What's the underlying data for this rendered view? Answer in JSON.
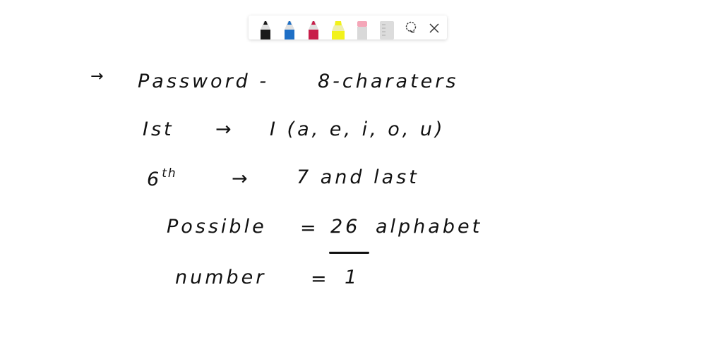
{
  "toolbar": {
    "tools": [
      {
        "name": "black-pen",
        "color": "#1a1a1a"
      },
      {
        "name": "blue-pen",
        "color": "#1e6fc6"
      },
      {
        "name": "red-pen",
        "color": "#c81e4a"
      },
      {
        "name": "yellow-highlighter",
        "color": "#f2f21a"
      },
      {
        "name": "eraser",
        "color": "#f4a6b8"
      },
      {
        "name": "ruler",
        "color": "#d8d8d8"
      }
    ],
    "lasso_icon": "lasso-icon",
    "close_icon": "close-icon"
  },
  "notes": {
    "line1": {
      "arrow": "→",
      "left": "Password  -",
      "right": "8-charaters"
    },
    "line2": {
      "left": "Ist",
      "arrow": "→",
      "right": "I  (a, e, i, o, u)"
    },
    "line3": {
      "left": "6",
      "sup": "th",
      "arrow": "→",
      "right": "7  and  last"
    },
    "line4": {
      "left": "Possible",
      "eq": "=",
      "value": "26",
      "right": "alphabet"
    },
    "line5": {
      "left": "number",
      "eq": "=",
      "value": "1"
    }
  }
}
